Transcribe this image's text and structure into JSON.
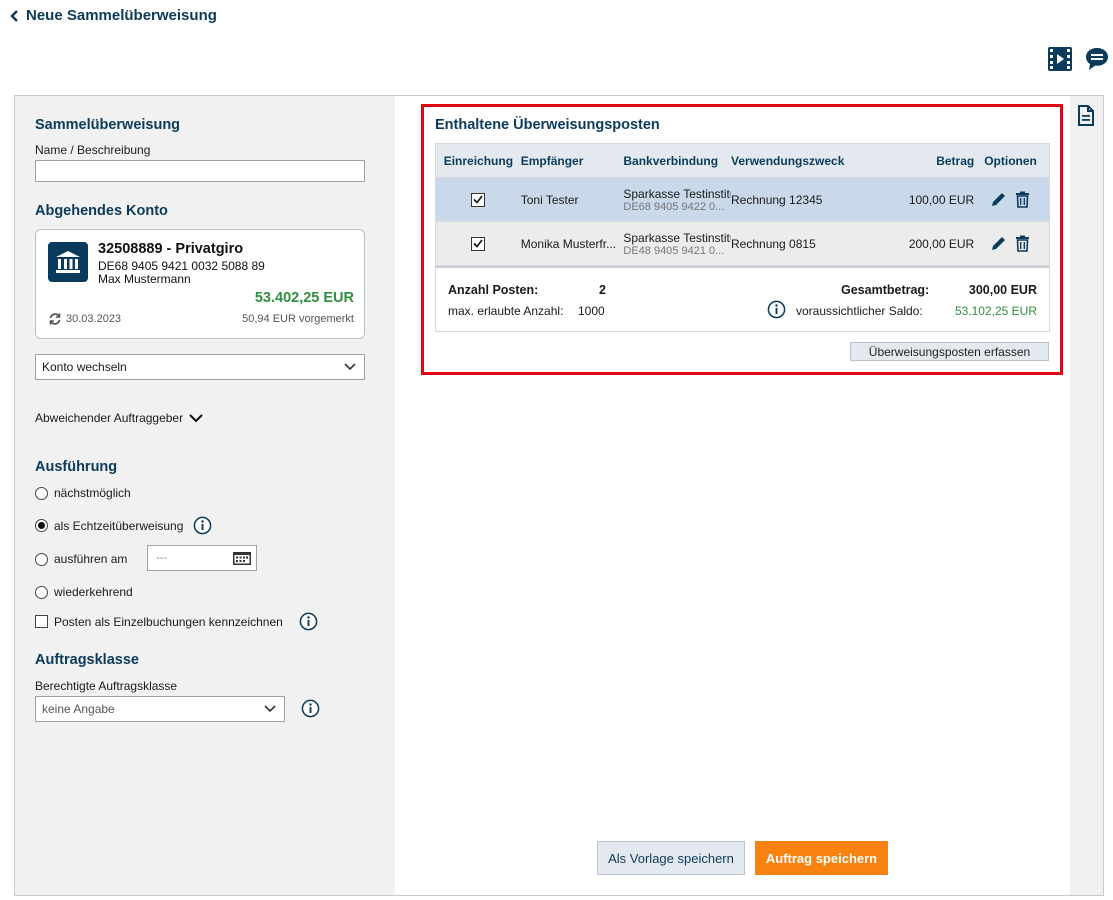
{
  "header": {
    "back_label": "Neue Sammelüberweisung",
    "video_icon": "film-icon",
    "chat_icon": "chat-bubble-icon",
    "document_icon": "document-icon"
  },
  "left": {
    "section_title": "Sammelüberweisung",
    "name_label": "Name / Beschreibung",
    "name_value": "",
    "account_title": "Abgehendes Konto",
    "account": {
      "name": "32508889 - Privatgiro",
      "iban": "DE68 9405 9421 0032 5088 89",
      "owner": "Max Mustermann",
      "balance": "53.402,25 EUR",
      "date": "30.03.2023",
      "pending": "50,94 EUR vorgemerkt"
    },
    "switch_account": "Konto wechseln",
    "different_payer": "Abweichender Auftraggeber",
    "execution_title": "Ausführung",
    "execution_options": {
      "asap": "nächstmöglich",
      "instant": "als Echtzeitüberweisung",
      "on_date": "ausführen am",
      "date_placeholder": "---",
      "recurring": "wiederkehrend"
    },
    "single_booking": "Posten als Einzelbuchungen kennzeichnen",
    "order_class_title": "Auftragsklasse",
    "order_class_label": "Berechtigte Auftragsklasse",
    "order_class_value": "keine Angabe"
  },
  "right": {
    "title": "Enthaltene Überweisungsposten",
    "columns": [
      "Einreichung",
      "Empfänger",
      "Bankverbindung",
      "Verwendungszweck",
      "Betrag",
      "Optionen"
    ],
    "rows": [
      {
        "submitted": true,
        "recipient": "Toni Tester",
        "bank_name": "Sparkasse Testinstitut",
        "bank_iban": "DE68 9405 9422 0...",
        "purpose": "Rechnung 12345",
        "amount": "100,00 EUR"
      },
      {
        "submitted": true,
        "recipient": "Monika Musterfr...",
        "bank_name": "Sparkasse Testinstitut",
        "bank_iban": "DE48 9405 9421 0...",
        "purpose": "Rechnung 0815",
        "amount": "200,00 EUR"
      }
    ],
    "summary": {
      "count_label": "Anzahl Posten:",
      "count_value": "2",
      "max_label": "max. erlaubte Anzahl:",
      "max_value": "1000",
      "total_label": "Gesamtbetrag:",
      "total_value": "300,00 EUR",
      "projected_label": "voraussichtlicher Saldo:",
      "projected_value": "53.102,25 EUR"
    },
    "add_item_button": "Überweisungsposten erfassen"
  },
  "footer": {
    "save_template": "Als Vorlage speichern",
    "save_order": "Auftrag speichern"
  },
  "colors": {
    "navy": "#0b3b5c",
    "positive": "#2f8f3e",
    "primary_button": "#f7820f",
    "highlight": "#e30613"
  }
}
